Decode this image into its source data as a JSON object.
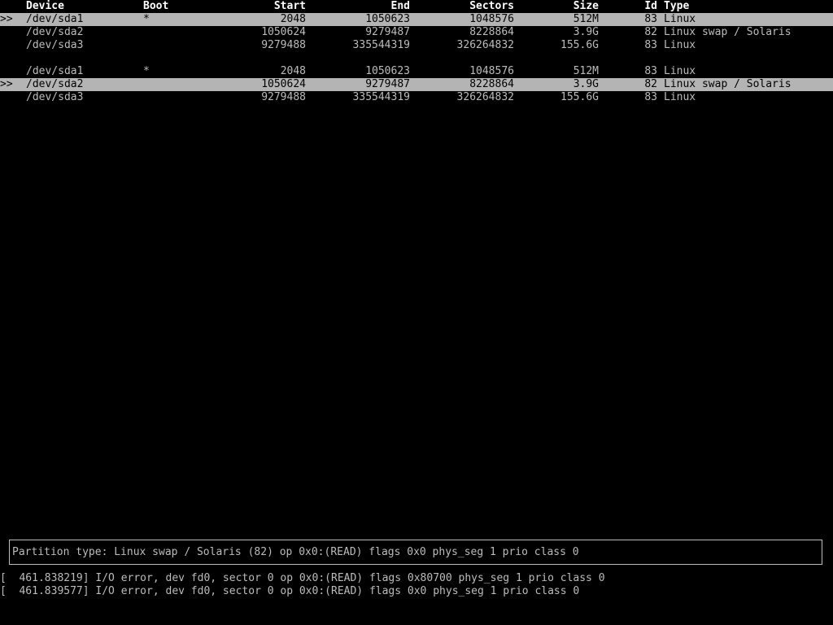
{
  "header": {
    "device": "Device",
    "boot": "Boot",
    "start": "Start",
    "end": "End",
    "sectors": "Sectors",
    "size": "Size",
    "id": "Id",
    "type": "Type"
  },
  "table1": {
    "rows": [
      {
        "pointer": ">>",
        "device": "/dev/sda1",
        "boot": "*",
        "start": "2048",
        "end": "1050623",
        "sectors": "1048576",
        "size": "512M",
        "id": "83",
        "type": "Linux"
      },
      {
        "pointer": "",
        "device": "/dev/sda2",
        "boot": "",
        "start": "1050624",
        "end": "9279487",
        "sectors": "8228864",
        "size": "3.9G",
        "id": "82",
        "type": "Linux swap / Solaris"
      },
      {
        "pointer": "",
        "device": "/dev/sda3",
        "boot": "",
        "start": "9279488",
        "end": "335544319",
        "sectors": "326264832",
        "size": "155.6G",
        "id": "83",
        "type": "Linux"
      }
    ]
  },
  "table2": {
    "rows": [
      {
        "pointer": "",
        "device": "/dev/sda1",
        "boot": "*",
        "start": "2048",
        "end": "1050623",
        "sectors": "1048576",
        "size": "512M",
        "id": "83",
        "type": "Linux"
      },
      {
        "pointer": ">>",
        "device": "/dev/sda2",
        "boot": "",
        "start": "1050624",
        "end": "9279487",
        "sectors": "8228864",
        "size": "3.9G",
        "id": "82",
        "type": "Linux swap / Solaris"
      },
      {
        "pointer": "",
        "device": "/dev/sda3",
        "boot": "",
        "start": "9279488",
        "end": "335544319",
        "sectors": "326264832",
        "size": "155.6G",
        "id": "83",
        "type": "Linux"
      }
    ]
  },
  "info": {
    "text": "Partition type: Linux swap / Solaris (82) op 0x0:(READ) flags 0x0 phys_seg 1 prio class 0"
  },
  "log": [
    "[  461.838219] I/O error, dev fd0, sector 0 op 0x0:(READ) flags 0x80700 phys_seg 1 prio class 0",
    "[  461.839577] I/O error, dev fd0, sector 0 op 0x0:(READ) flags 0x0 phys_seg 1 prio class 0"
  ],
  "colors": {
    "background": "#000000",
    "text": "#bcbcbc",
    "header": "#ffffff",
    "selection_bg": "#b4b4b4",
    "selection_fg": "#000000"
  }
}
